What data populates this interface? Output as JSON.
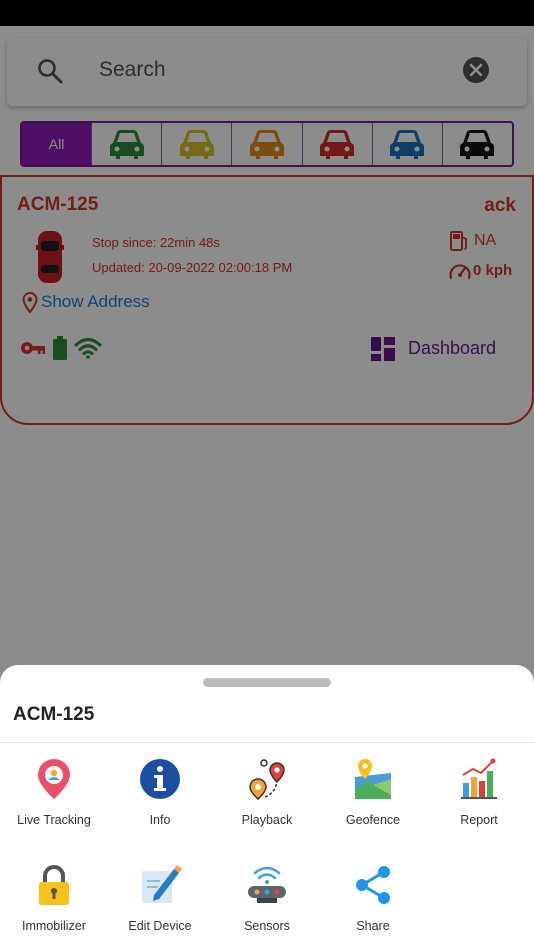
{
  "search": {
    "placeholder": "Search"
  },
  "filters": {
    "all_label": "All"
  },
  "vehicle": {
    "name": "ACM-125",
    "ack": "ack",
    "stop_since": "Stop since: 22min 48s",
    "updated": "Updated: 20-09-2022 02:00:18 PM",
    "fuel": "NA",
    "speed": "0 kph",
    "show_address": "Show Address",
    "dashboard": "Dashboard"
  },
  "colors": {
    "accent": "#8e1ab5",
    "alert": "#d03a2a",
    "link": "#2b7ac4",
    "filter_green": "#2e8b3a",
    "filter_yellow": "#d9c227",
    "filter_orange": "#e58a1a",
    "filter_red": "#d42a2a",
    "filter_blue": "#1f6fc4",
    "filter_black": "#111111"
  },
  "sheet": {
    "title": "ACM-125",
    "actions": [
      {
        "label": "Live Tracking",
        "icon": "live-tracking-icon"
      },
      {
        "label": "Info",
        "icon": "info-icon"
      },
      {
        "label": "Playback",
        "icon": "playback-icon"
      },
      {
        "label": "Geofence",
        "icon": "geofence-icon"
      },
      {
        "label": "Report",
        "icon": "report-icon"
      },
      {
        "label": "Immobilizer",
        "icon": "immobilizer-icon"
      },
      {
        "label": "Edit Device",
        "icon": "edit-device-icon"
      },
      {
        "label": "Sensors",
        "icon": "sensors-icon"
      },
      {
        "label": "Share",
        "icon": "share-icon"
      }
    ]
  }
}
